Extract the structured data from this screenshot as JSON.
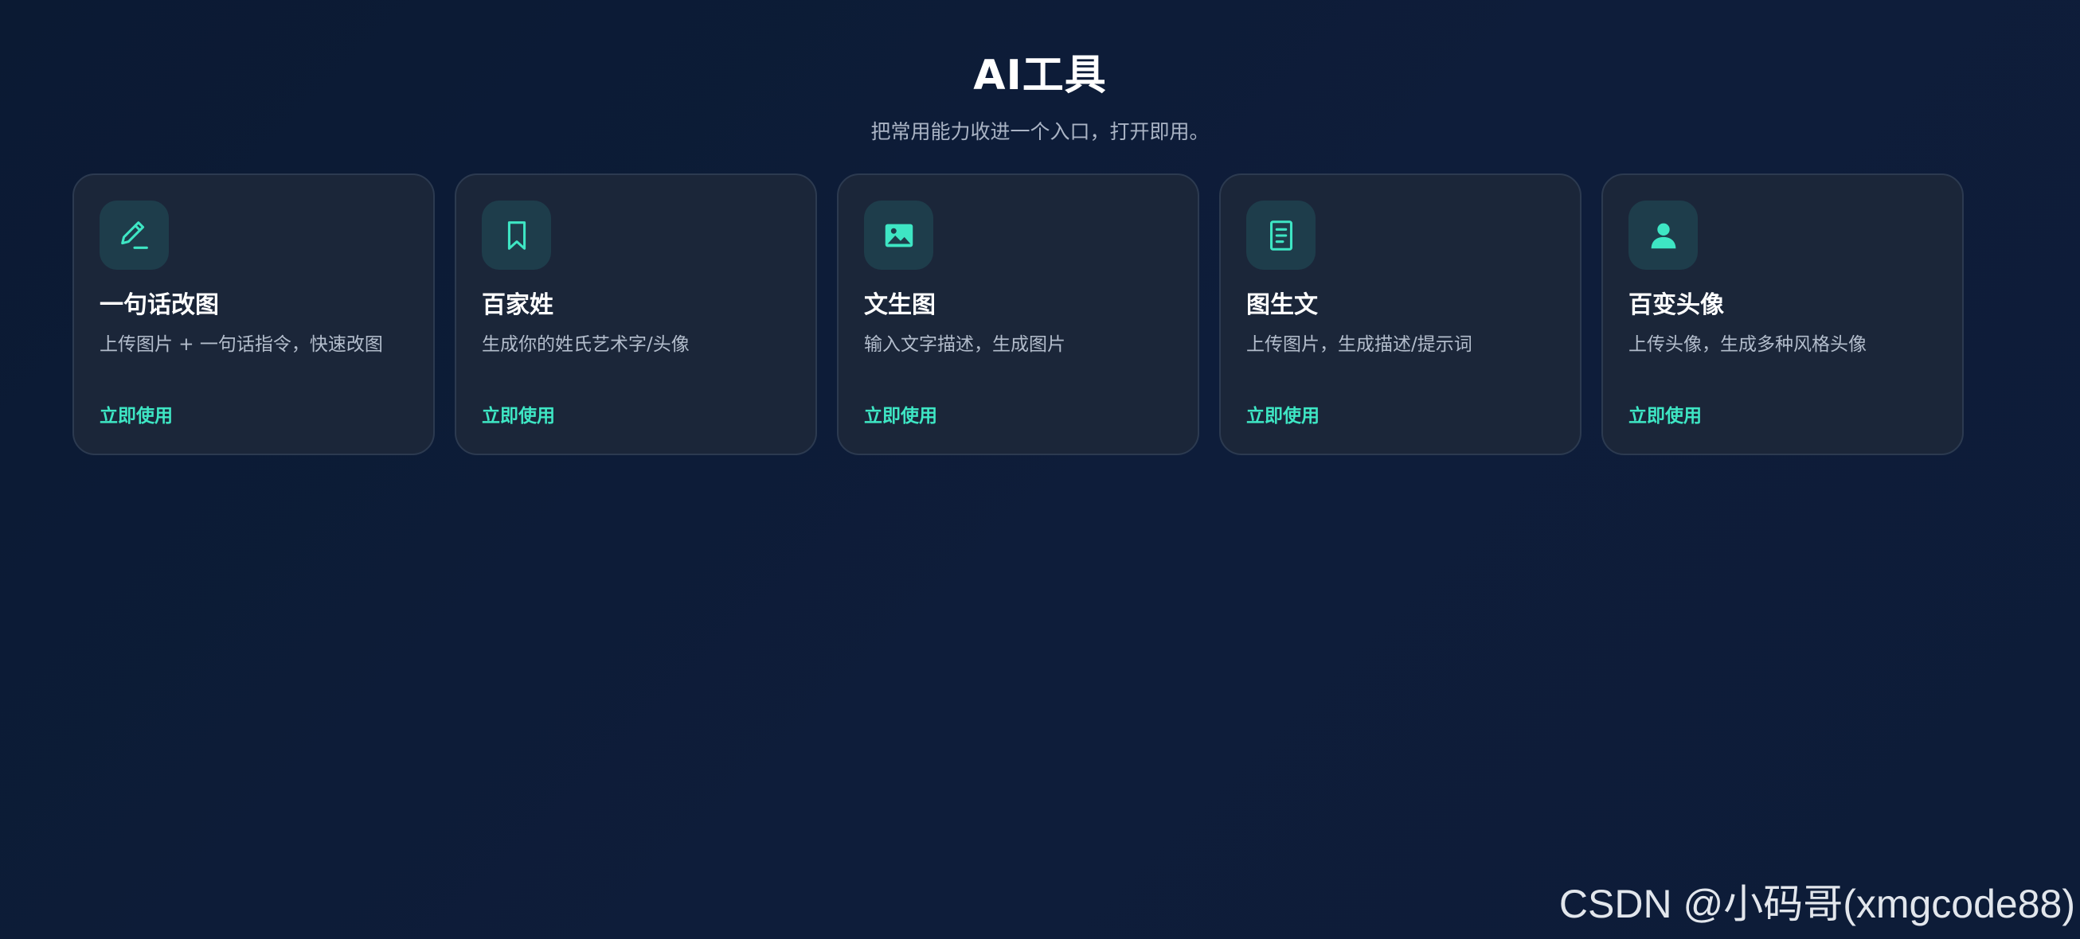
{
  "header": {
    "title": "AI工具",
    "subtitle": "把常用能力收进一个入口，打开即用。"
  },
  "cards": [
    {
      "icon": "pencil-edit-icon",
      "title": "一句话改图",
      "description": "上传图片 + 一句话指令，快速改图",
      "action": "立即使用"
    },
    {
      "icon": "bookmark-icon",
      "title": "百家姓",
      "description": "生成你的姓氏艺术字/头像",
      "action": "立即使用"
    },
    {
      "icon": "image-icon",
      "title": "文生图",
      "description": "输入文字描述，生成图片",
      "action": "立即使用"
    },
    {
      "icon": "document-icon",
      "title": "图生文",
      "description": "上传图片，生成描述/提示词",
      "action": "立即使用"
    },
    {
      "icon": "user-avatar-icon",
      "title": "百变头像",
      "description": "上传头像，生成多种风格头像",
      "action": "立即使用"
    }
  ],
  "watermark": "CSDN @小码哥(xmgcode88)",
  "colors": {
    "background": "#0d1c38",
    "card_background": "#1b2639",
    "card_border": "#2c3a50",
    "icon_tile": "#1e3d4b",
    "accent": "#3ee6c4",
    "subtitle_text": "#aab4c5",
    "description_text": "#b3bdcc"
  }
}
